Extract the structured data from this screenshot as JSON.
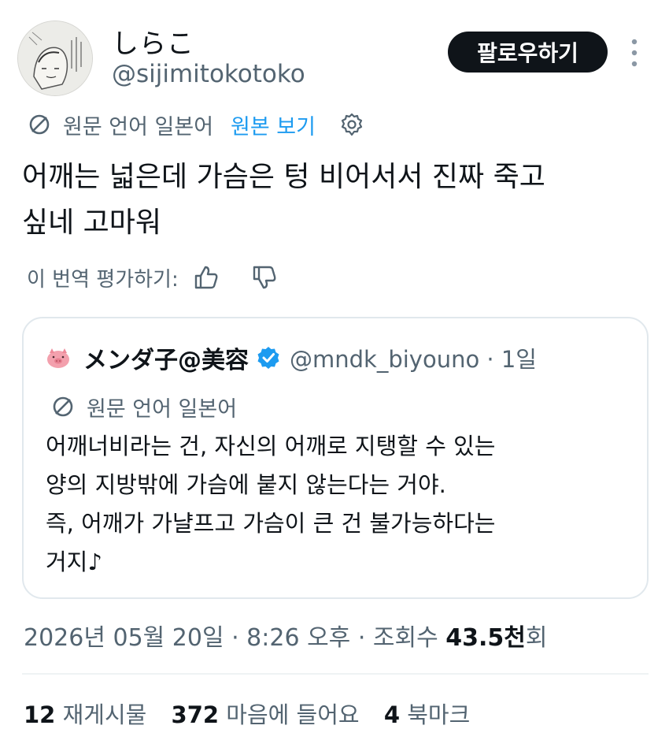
{
  "author": {
    "display_name": "しらこ",
    "handle": "@sijimitokotoko"
  },
  "follow_button": {
    "label": "팔로우하기"
  },
  "translation": {
    "source_label": "원문 언어 일본어",
    "view_original_label": "원본 보기"
  },
  "tweet": {
    "text_line1": "어깨는 넓은데 가슴은 텅 비어서서 진짜 죽고",
    "text_line2": "싶네 고마워"
  },
  "rate_translation": {
    "label": "이 번역 평가하기:"
  },
  "quoted_tweet": {
    "display_name": "メンダ子@美容",
    "handle_time": "@mndk_biyouno · 1일",
    "translation_label": "원문 언어 일본어",
    "lines": [
      "어깨너비라는 건, 자신의 어깨로 지탱할 수 있는",
      "양의 지방밖에 가슴에 붙지 않는다는 거야.",
      "즉, 어깨가 가냘프고 가슴이 큰 건 불가능하다는",
      "거지♪"
    ]
  },
  "meta": {
    "datetime": "2026년 05월 20일 · 8:26 오후 · 조회수 ",
    "views_number": "43.5천",
    "views_suffix": "회"
  },
  "stats": {
    "reposts_count": "12",
    "reposts_label": "재게시물",
    "likes_count": "372",
    "likes_label": "마음에 들어요",
    "bookmarks_count": "4",
    "bookmarks_label": "북마크"
  },
  "colors": {
    "text": "#0f1419",
    "secondary": "#536471",
    "link": "#1d9bf0",
    "verified": "#1d9bf0",
    "button_bg": "#0f1419"
  },
  "icons": [
    "avatar",
    "more-vertical-icon",
    "translate-icon",
    "settings-gear-icon",
    "thumbs-up-icon",
    "thumbs-down-icon",
    "pig-avatar-icon",
    "verified-badge-icon"
  ]
}
